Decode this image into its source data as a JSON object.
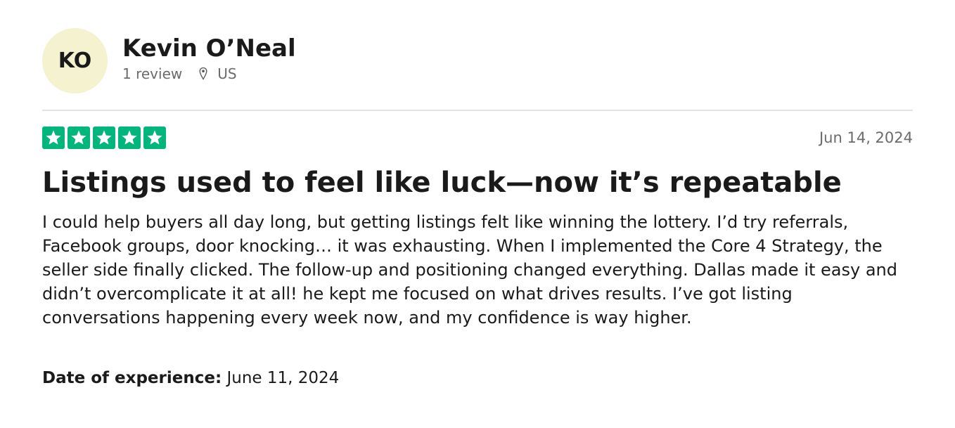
{
  "reviewer": {
    "initials": "KO",
    "name": "Kevin O’Neal",
    "review_count": "1 review",
    "location_icon": "location-pin-icon",
    "country": "US"
  },
  "review": {
    "rating": 5,
    "rating_max": 5,
    "star_color": "#00b67a",
    "date": "Jun 14, 2024",
    "title": "Listings used to feel like luck—now it’s repeatable",
    "body": "I could help buyers all day long, but getting listings felt like winning the lottery. I’d try referrals, Facebook groups, door knocking… it was exhausting. When I implemented the Core 4 Strategy, the seller side finally clicked. The follow-up and positioning changed everything. Dallas made it easy and didn’t overcomplicate it at all! he kept me focused on what drives results. I’ve got listing conversations happening every week now, and my confidence is way higher.",
    "experience_label": "Date of experience:",
    "experience_date": "June 11, 2024"
  },
  "colors": {
    "avatar_bg": "#f5f2cf",
    "muted_text": "#6b6b6b",
    "divider": "#e3e3e3"
  }
}
